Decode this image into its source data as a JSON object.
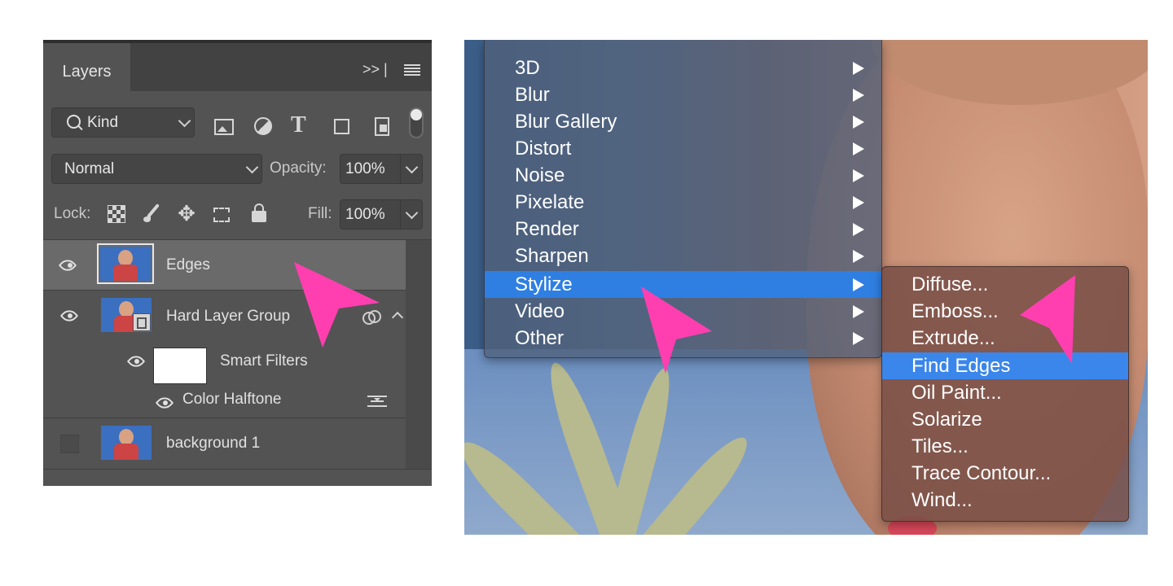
{
  "layers_panel": {
    "tab_label": "Layers",
    "tab_icons": ">>  |",
    "filter": {
      "label": "Kind"
    },
    "blend_mode": "Normal",
    "opacity_label": "Opacity:",
    "opacity_value": "100%",
    "lock_label": "Lock:",
    "fill_label": "Fill:",
    "fill_value": "100%",
    "layers": [
      {
        "name": "Edges",
        "selected": true,
        "visible": true
      },
      {
        "name": "Hard Layer Group",
        "selected": false,
        "visible": true
      },
      {
        "name": "Smart Filters",
        "visible": true
      },
      {
        "name": "Color Halftone",
        "visible": true
      },
      {
        "name": "background 1",
        "visible": false
      }
    ]
  },
  "filter_menu": {
    "items": [
      {
        "label": "3D"
      },
      {
        "label": "Blur"
      },
      {
        "label": "Blur Gallery"
      },
      {
        "label": "Distort"
      },
      {
        "label": "Noise"
      },
      {
        "label": "Pixelate"
      },
      {
        "label": "Render"
      },
      {
        "label": "Sharpen"
      },
      {
        "label": "Stylize",
        "selected": true
      },
      {
        "label": "Video"
      },
      {
        "label": "Other"
      }
    ],
    "stylize_submenu": [
      {
        "label": "Diffuse..."
      },
      {
        "label": "Emboss..."
      },
      {
        "label": "Extrude..."
      },
      {
        "label": "Find Edges",
        "selected": true
      },
      {
        "label": "Oil Paint..."
      },
      {
        "label": "Solarize"
      },
      {
        "label": "Tiles..."
      },
      {
        "label": "Trace Contour..."
      },
      {
        "label": "Wind..."
      }
    ]
  },
  "colors": {
    "accent_pointer": "#ff3fb0",
    "menu_selection": "#2f7fe2",
    "panel_bg": "#535353"
  }
}
